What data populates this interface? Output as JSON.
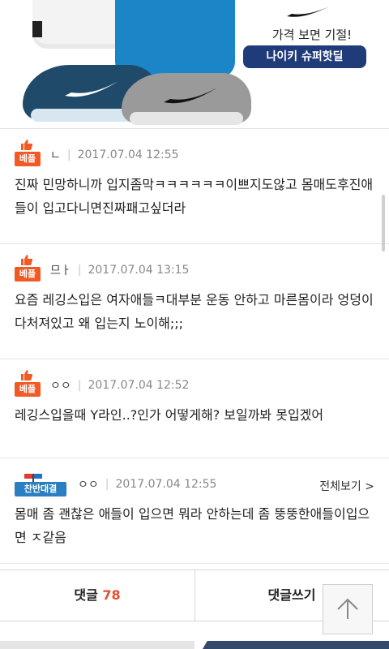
{
  "ad": {
    "headline": "가격 보면 기절!",
    "badge": "나이키 슈퍼핫딜"
  },
  "comments": [
    {
      "badge": "베플",
      "author": "ㄴ",
      "date": "2017.07.04 12:55",
      "text": "진짜 민망하니까 입지좀막ㅋㅋㅋㅋㅋㅋ이쁘지도않고 몸매도후진애들이 입고다니면진짜패고싶더라"
    },
    {
      "badge": "베플",
      "author": "므ㅏ",
      "date": "2017.07.04 13:15",
      "text": "요즘 레깅스입은 여자애들ㅋ대부분 운동 안하고 마른몸이라 엉덩이다처져있고 왜 입는지 노이해;;;"
    },
    {
      "badge": "베플",
      "author": "ㅇㅇ",
      "date": "2017.07.04 12:52",
      "text": "레깅스입을때 Y라인..?인가 어떻게해? 보일까봐 못입겠어"
    },
    {
      "badge": "찬반대결",
      "author": "ㅇㅇ",
      "date": "2017.07.04 12:55",
      "view_all": "전체보기 >",
      "text": "몸매 좀 괜찮은 애들이 입으면 뭐라 안하는데 좀 뚱뚱한애들이입으면 ㅈ같음"
    }
  ],
  "bottom_bar": {
    "comments_label": "댓글",
    "comments_count": "78",
    "write_label": "댓글쓰기"
  },
  "colors": {
    "best_badge": "#f15a24",
    "debate_badge": "#2a7fc0",
    "count": "#e44f2e",
    "ad_badge_bg": "#1f3b79"
  },
  "icons": {
    "thumb": "thumbs-up-icon",
    "flags": "flags-icon",
    "top": "arrow-up-icon",
    "logo": "swoosh-logo"
  }
}
